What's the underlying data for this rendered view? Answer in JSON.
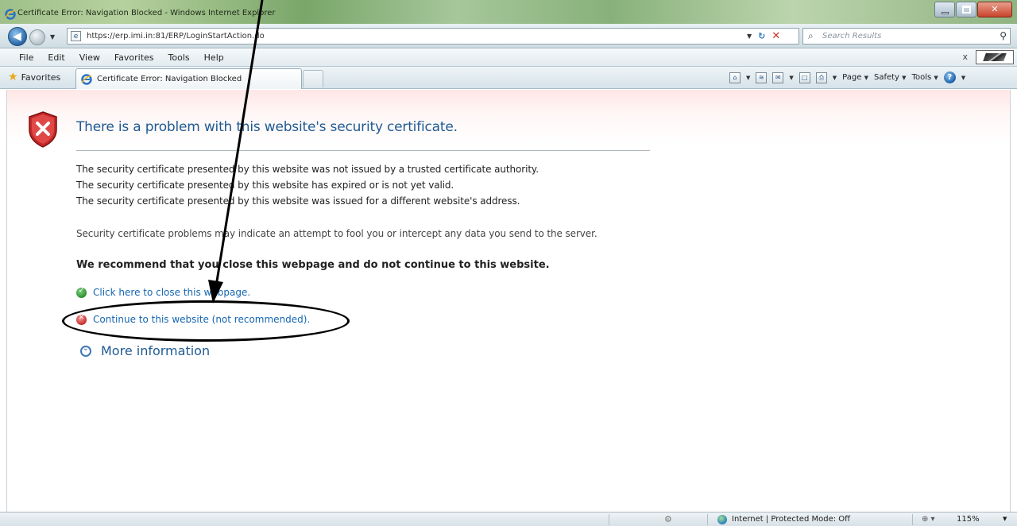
{
  "window": {
    "title": "Certificate Error: Navigation Blocked - Windows Internet Explorer"
  },
  "address_bar": {
    "url": "https://erp.imi.in:81/ERP/LoginStartAction.do",
    "search_placeholder": "Search Results"
  },
  "menu": {
    "items": [
      "File",
      "Edit",
      "View",
      "Favorites",
      "Tools",
      "Help"
    ],
    "close_label": "x"
  },
  "favorites_bar": {
    "favorites_label": "Favorites",
    "tab_title": "Certificate Error: Navigation Blocked"
  },
  "command_bar": {
    "page_label": "Page",
    "safety_label": "Safety",
    "tools_label": "Tools"
  },
  "content": {
    "heading": "There is a problem with this website's security certificate.",
    "paragraphs": [
      "The security certificate presented by this website was not issued by a trusted certificate authority.",
      "The security certificate presented by this website has expired or is not yet valid.",
      "The security certificate presented by this website was issued for a different website's address."
    ],
    "warning": "Security certificate problems may indicate an attempt to fool you or intercept any data you send to the server.",
    "recommendation": "We recommend that you close this webpage and do not continue to this website.",
    "close_link": "Click here to close this webpage.",
    "continue_link": "Continue to this website (not recommended).",
    "more_info": "More information"
  },
  "status_bar": {
    "zone": "Internet | Protected Mode: Off",
    "zoom": "115%"
  },
  "colors": {
    "heading": "#1f5a92",
    "link": "#1565b0",
    "shield_red": "#c62828",
    "safe_green": "#2b8a2b"
  }
}
